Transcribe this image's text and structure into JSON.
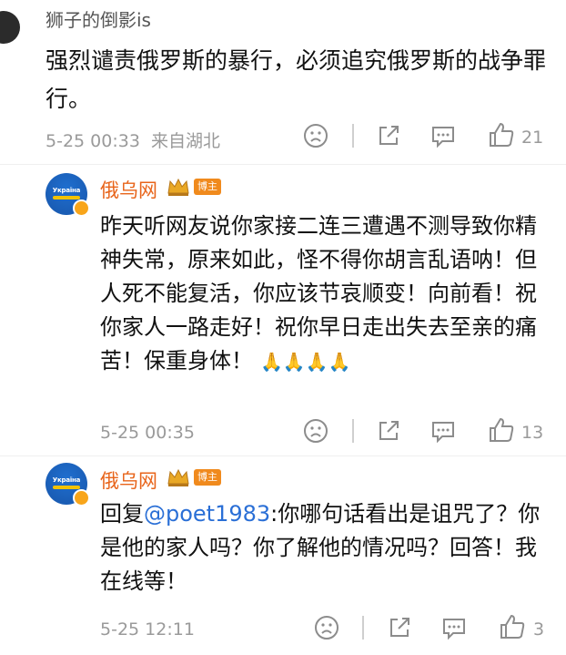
{
  "comment1": {
    "username": "狮子的倒影is",
    "text": "强烈谴责俄罗斯的暴行，必须追究俄罗斯的战争罪行。",
    "time": "5-25 00:33",
    "location": "来自湖北",
    "likes": "21"
  },
  "reply1": {
    "username": "俄乌网",
    "badge": "博主",
    "avatar_label": "Україна",
    "text": "昨天听网友说你家接二连三遭遇不测导致你精神失常，原来如此，怪不得你胡言乱语呐！但人死不能复活，你应该节哀顺变！向前看！祝你家人一路走好！祝你早日走出失去至亲的痛苦！保重身体！",
    "emoji": "🙏🙏🙏🙏",
    "time": "5-25 00:35",
    "likes": "13"
  },
  "reply2": {
    "username": "俄乌网",
    "badge": "博主",
    "avatar_label": "Україна",
    "prefix": "回复",
    "mention": "@poet1983",
    "text": ":你哪句话看出是诅咒了？你是他的家人吗？你了解他的情况吗？回答！我在线等！",
    "time": "5-25 12:11",
    "likes": "3"
  },
  "colors": {
    "username_accent": "#e8641a",
    "mention": "#2a6fd6",
    "meta_gray": "#9a9a9a"
  },
  "icons": [
    "sad-face-icon",
    "share-icon",
    "comment-icon",
    "like-thumb-icon",
    "crown-icon",
    "verified-icon"
  ]
}
